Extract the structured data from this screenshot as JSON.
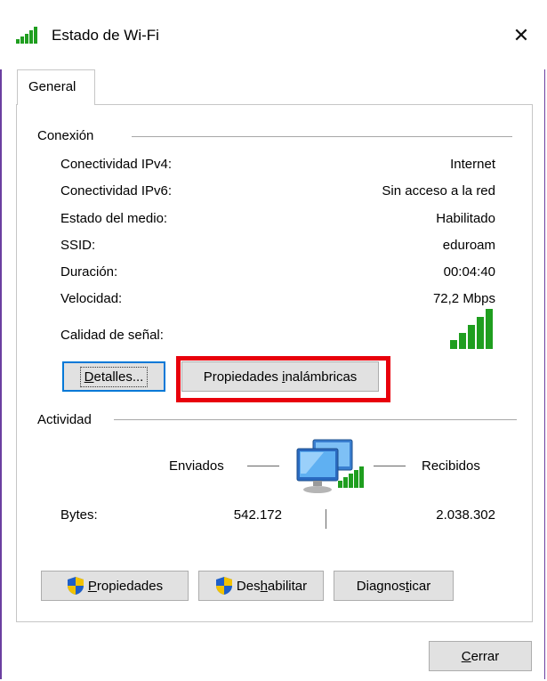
{
  "window": {
    "title": "Estado de Wi-Fi",
    "close_glyph": "✕"
  },
  "tabs": [
    {
      "label": "General"
    }
  ],
  "connection": {
    "group_label": "Conexión",
    "rows": [
      {
        "label": "Conectividad IPv4:",
        "value": "Internet"
      },
      {
        "label": "Conectividad IPv6:",
        "value": "Sin acceso a la red"
      },
      {
        "label": "Estado del medio:",
        "value": "Habilitado"
      },
      {
        "label": "SSID:",
        "value": "eduroam"
      },
      {
        "label": "Duración:",
        "value": "00:04:40"
      },
      {
        "label": "Velocidad:",
        "value": "72,2 Mbps"
      }
    ],
    "signal_label": "Calidad de señal:",
    "signal_bars_active": 5,
    "signal_bars_total": 5,
    "details_button": {
      "prefix": "",
      "accel": "D",
      "rest": "etalles..."
    },
    "wireless_button": {
      "prefix": "Propiedades ",
      "accel": "i",
      "rest": "nalámbricas"
    }
  },
  "activity": {
    "group_label": "Actividad",
    "sent_label": "Enviados",
    "received_label": "Recibidos",
    "bytes_label": "Bytes:",
    "bytes_sent": "542.172",
    "bytes_received": "2.038.302"
  },
  "bottom_buttons": {
    "properties": {
      "prefix": "",
      "accel": "P",
      "rest": "ropiedades"
    },
    "disable": {
      "prefix": "Des",
      "accel": "h",
      "rest": "abilitar"
    },
    "diagnose": {
      "prefix": "Diagnos",
      "accel": "t",
      "rest": "icar"
    }
  },
  "close_button": {
    "prefix": "",
    "accel": "C",
    "rest": "errar"
  },
  "colors": {
    "signal_green": "#1f9e1f",
    "accent_blue": "#0078d7",
    "highlight_red": "#e8000b"
  },
  "icons": {
    "title": "wifi-signal-icon",
    "network": "network-computers-icon",
    "shield": "uac-shield-icon"
  }
}
